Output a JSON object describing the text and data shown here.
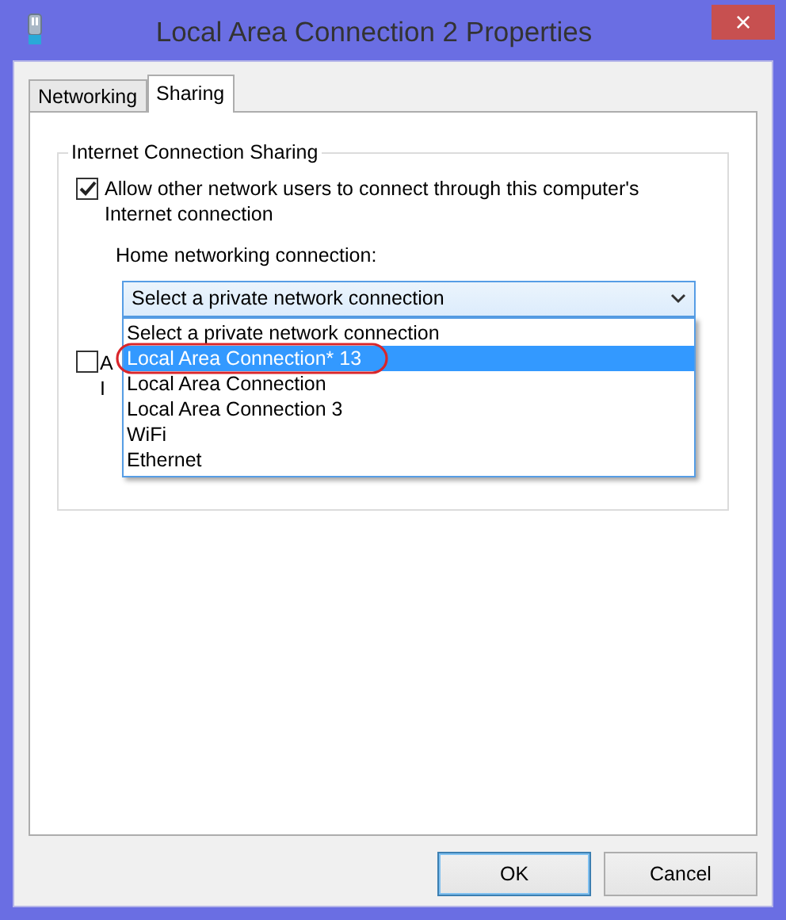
{
  "window": {
    "title": "Local Area Connection 2 Properties",
    "close": "×"
  },
  "tabs": [
    {
      "label": "Networking",
      "selected": false
    },
    {
      "label": "Sharing",
      "selected": true
    }
  ],
  "group": {
    "title": "Internet Connection Sharing",
    "allow_option": {
      "label": "Allow other network users to connect through this computer's Internet connection",
      "checked": true
    },
    "home_label": "Home networking connection:",
    "dropdown": {
      "value": "Select a private network connection",
      "expanded": true,
      "options": [
        {
          "label": "Select a private network connection",
          "highlighted": false,
          "circled": false
        },
        {
          "label": "Local Area Connection* 13",
          "highlighted": true,
          "circled": true
        },
        {
          "label": "Local Area Connection",
          "highlighted": false,
          "circled": false
        },
        {
          "label": "Local Area Connection 3",
          "highlighted": false,
          "circled": false
        },
        {
          "label": "WiFi",
          "highlighted": false,
          "circled": false
        },
        {
          "label": "Ethernet",
          "highlighted": false,
          "circled": false
        }
      ]
    },
    "second_option": {
      "checked": false,
      "label_lines": [
        "A",
        "I"
      ]
    }
  },
  "buttons": [
    {
      "label": "OK",
      "default": true
    },
    {
      "label": "Cancel",
      "default": false
    }
  ]
}
